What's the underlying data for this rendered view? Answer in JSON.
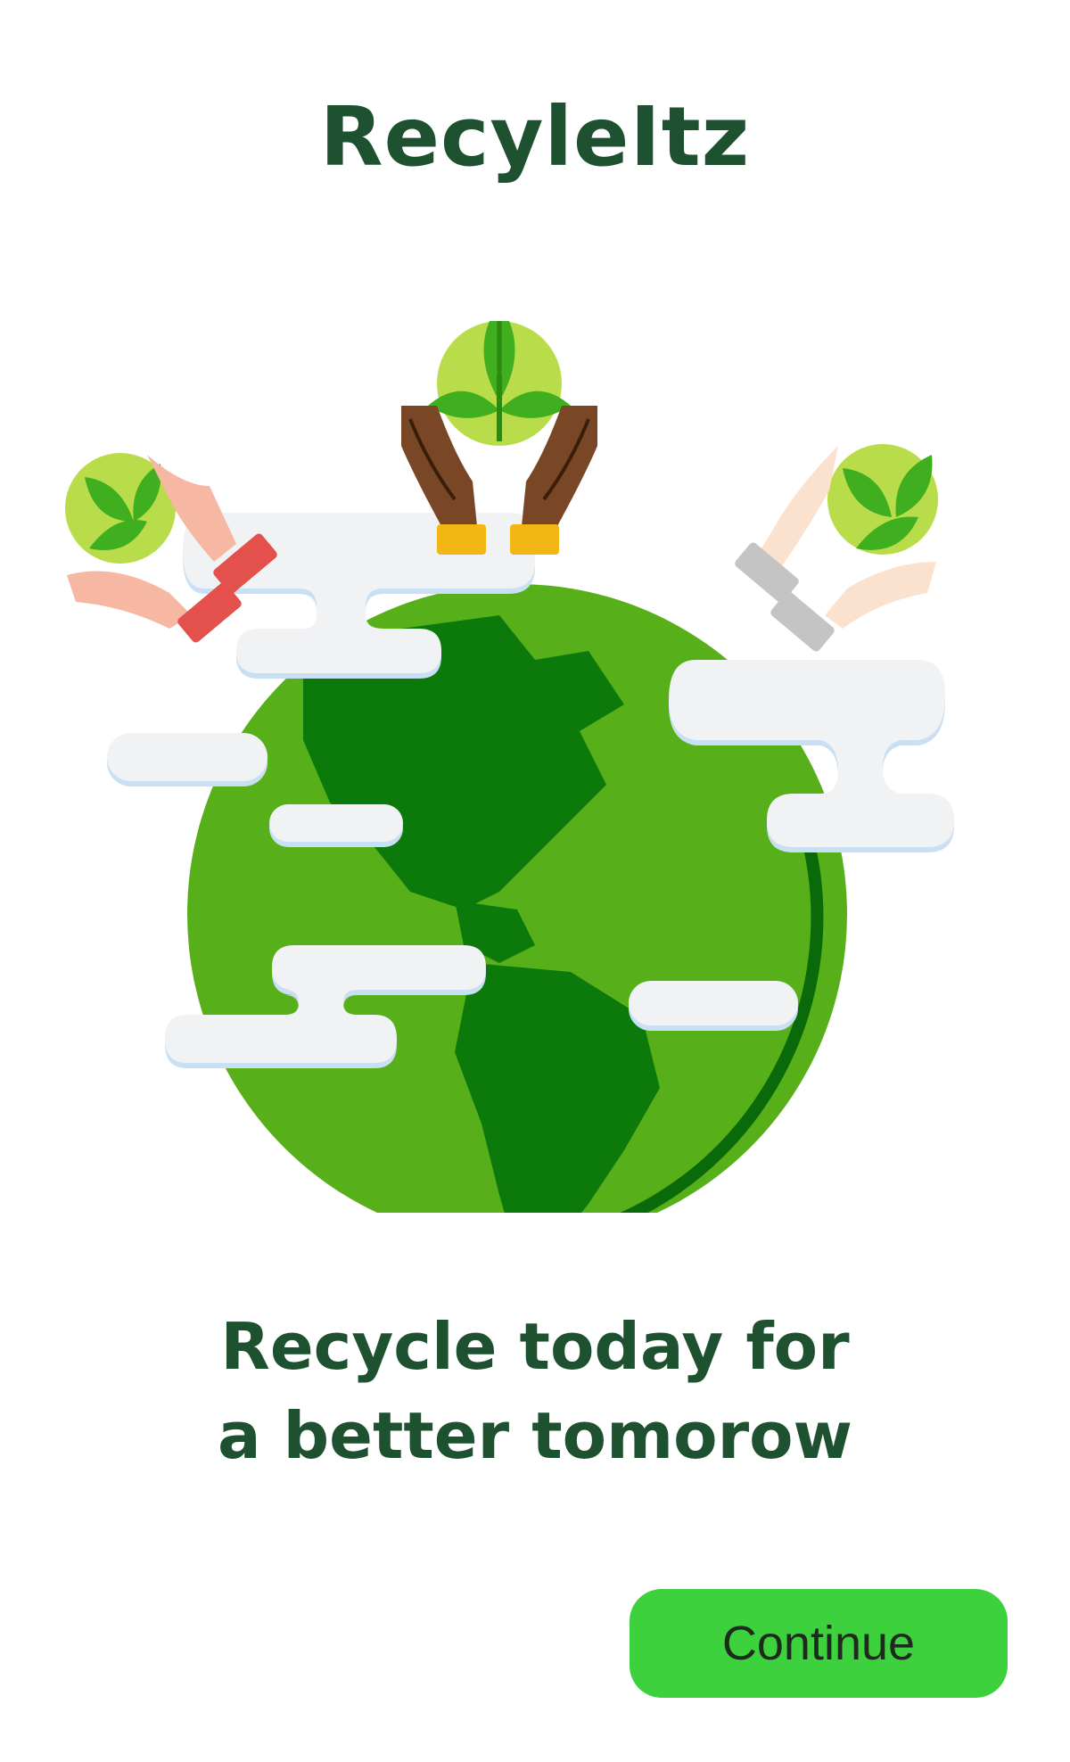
{
  "app": {
    "title": "RecyleItz"
  },
  "hero": {
    "icon": "earth-with-hands-holding-plants-illustration"
  },
  "main": {
    "tagline_line1": "Recycle today for",
    "tagline_line2": "a better tomorow"
  },
  "actions": {
    "continue_label": "Continue"
  },
  "colors": {
    "title_text": "#1e5130",
    "button_bg": "#3dd13d",
    "button_text": "#1f2a1f",
    "globe_ocean": "#57b019",
    "globe_land": "#0b7a0b",
    "cloud": "#f1f2f4",
    "cloud_shadow": "#c9dff3",
    "leaf": "#3fae1f",
    "leaf_bg": "#b9dc4a"
  }
}
